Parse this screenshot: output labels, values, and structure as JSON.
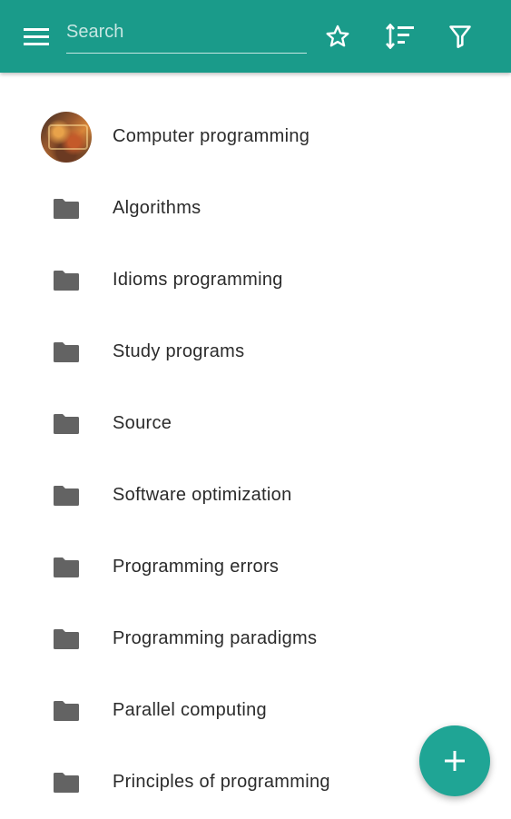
{
  "header": {
    "search_placeholder": "Search",
    "icons": [
      "menu-icon",
      "star-icon",
      "sort-icon",
      "filter-icon"
    ],
    "background_color": "#1a9b8a"
  },
  "list": {
    "items": [
      {
        "label": "Computer programming",
        "icon": "avatar-image"
      },
      {
        "label": "Algorithms",
        "icon": "folder-icon"
      },
      {
        "label": "Idioms programming",
        "icon": "folder-icon"
      },
      {
        "label": "Study programs",
        "icon": "folder-icon"
      },
      {
        "label": "Source",
        "icon": "folder-icon"
      },
      {
        "label": "Software optimization",
        "icon": "folder-icon"
      },
      {
        "label": "Programming errors",
        "icon": "folder-icon"
      },
      {
        "label": "Programming paradigms",
        "icon": "folder-icon"
      },
      {
        "label": "Parallel computing",
        "icon": "folder-icon"
      },
      {
        "label": "Principles of programming",
        "icon": "folder-icon"
      }
    ]
  },
  "fab": {
    "icon": "plus-icon",
    "color": "#1fa595"
  }
}
